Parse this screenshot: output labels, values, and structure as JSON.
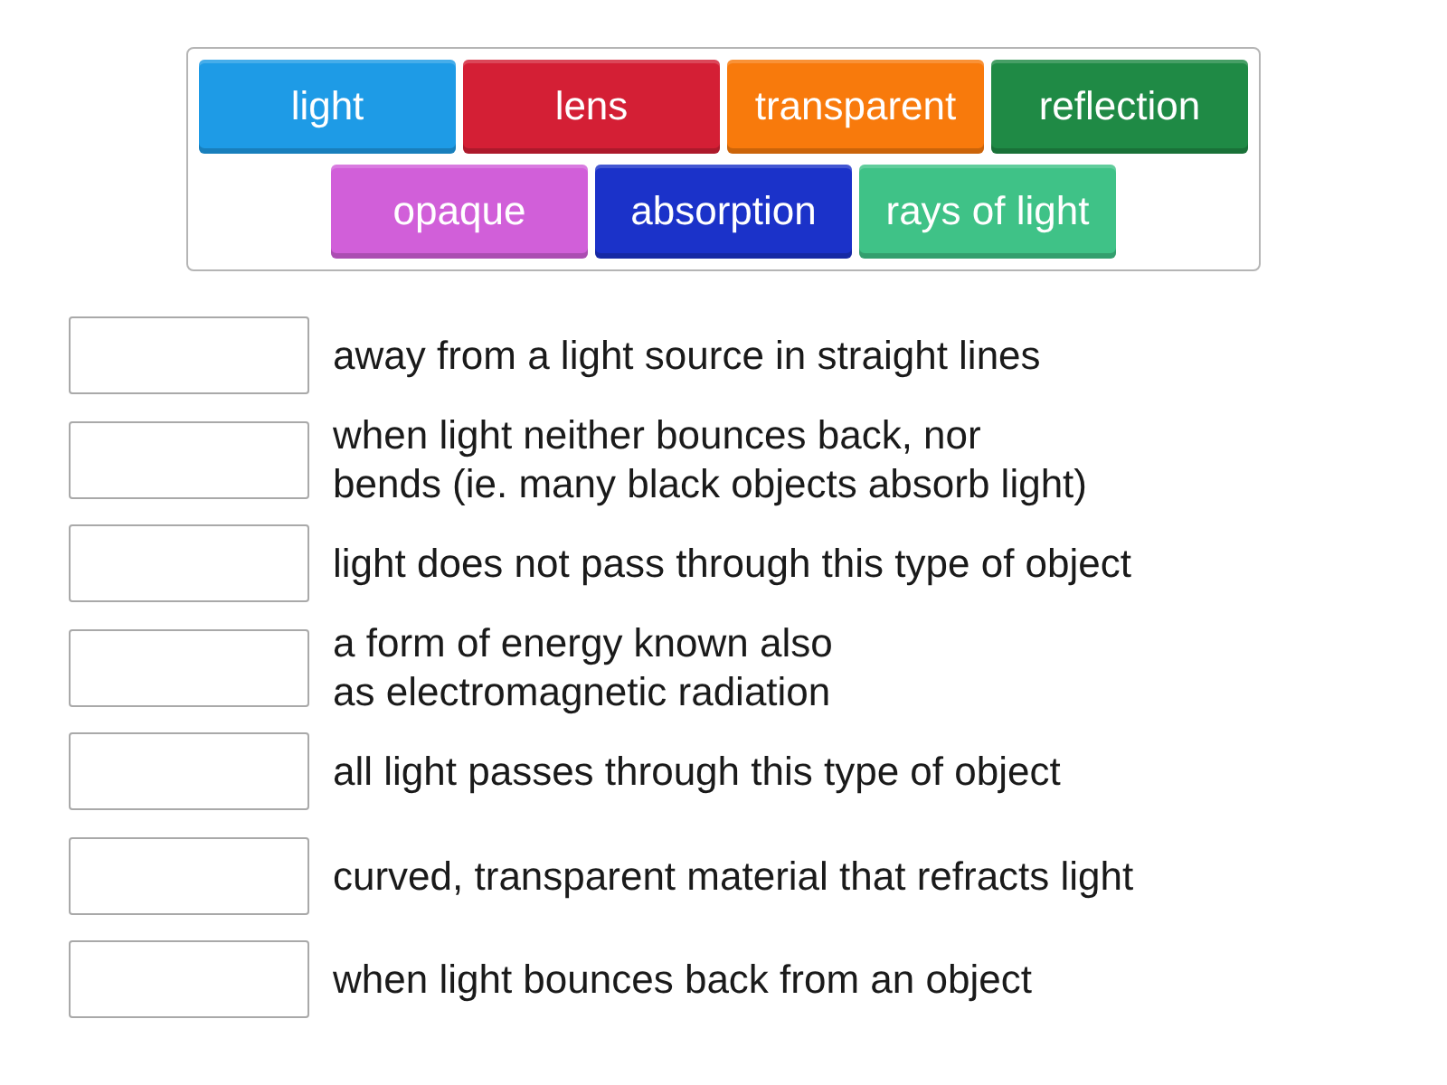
{
  "word_bank": {
    "tiles": [
      {
        "label": "light",
        "color": "#1e9be6"
      },
      {
        "label": "lens",
        "color": "#d41f35"
      },
      {
        "label": "transparent",
        "color": "#f87a0c"
      },
      {
        "label": "reflection",
        "color": "#1f8a45"
      },
      {
        "label": "opaque",
        "color": "#d15fd9"
      },
      {
        "label": "absorption",
        "color": "#1b32c9"
      },
      {
        "label": "rays of light",
        "color": "#3fc287"
      }
    ]
  },
  "rows": [
    {
      "text": "away from a light source in straight lines"
    },
    {
      "text": "when light neither bounces back, nor\nbends (ie. many black objects absorb light)"
    },
    {
      "text": "light does not pass through this type of object"
    },
    {
      "text": "a form of energy known also\nas electromagnetic radiation"
    },
    {
      "text": "all light passes through this type of object"
    },
    {
      "text": "curved, transparent material that refracts light"
    },
    {
      "text": "when light bounces back from an object"
    }
  ]
}
